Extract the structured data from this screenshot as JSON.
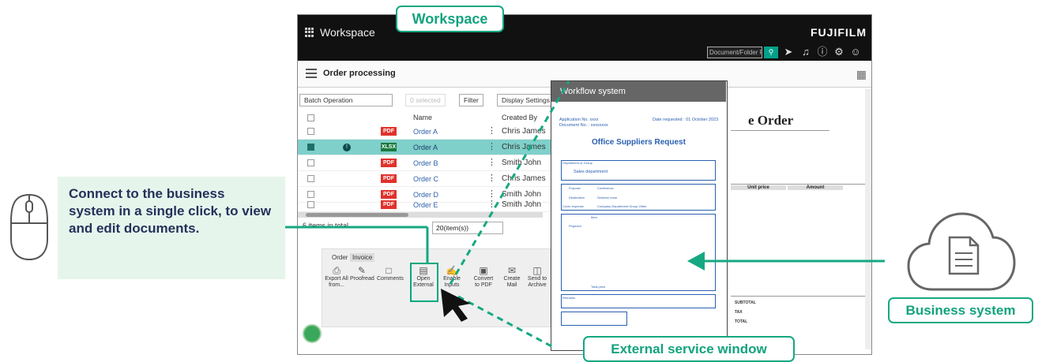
{
  "app": {
    "title": "Workspace",
    "brand": "FUJIFILM",
    "search_placeholder": "Document/Folder F"
  },
  "page": {
    "title": "Order processing"
  },
  "toolbar": {
    "batch": "Batch Operation",
    "unselect": "0 selected",
    "filter": "Filter",
    "display_settings": "Display Settings"
  },
  "table": {
    "headers": {
      "name": "Name",
      "created_by": "Created By"
    },
    "rows": [
      {
        "type": "PDF",
        "name": "Order A",
        "creator": "Chris James"
      },
      {
        "type": "XLSX",
        "name": "Order A",
        "creator": "Chris James"
      },
      {
        "type": "PDF",
        "name": "Order B",
        "creator": "Smith John"
      },
      {
        "type": "PDF",
        "name": "Order C",
        "creator": "Chris James"
      },
      {
        "type": "PDF",
        "name": "Order D",
        "creator": "Smith John"
      },
      {
        "type": "PDF",
        "name": "Order E",
        "creator": "Smith John"
      }
    ],
    "selected_index": 1
  },
  "footer": {
    "total": "6 items in total",
    "per_page": "20(item(s))"
  },
  "panel": {
    "tabs": [
      "Order",
      "Invoice"
    ],
    "actions": [
      "Export All from...",
      "Proofread",
      "Comments",
      "Open External",
      "Enable Inputs",
      "Convert to PDF",
      "Create Mail",
      "Send to Archive"
    ]
  },
  "doc_preview": {
    "title": "e Order",
    "labels": [
      "SUBTOTAL",
      "TAX",
      "TOTAL"
    ],
    "cols": [
      "Unit price",
      "Amount"
    ]
  },
  "workflow": {
    "header": "Workflow system",
    "app_no": "Application No. xxxx",
    "doc_no": "Document No. : xxxxxxxx",
    "date": "Date requested : 01 October 2023",
    "request_title": "Office Suppliers Request",
    "dept_headers": [
      "Department or Group",
      "Requested by",
      "User",
      "Signature"
    ],
    "dept_value": "Sales department",
    "purpose_label": "Purpose",
    "purpose_value": "Conference",
    "dest_label": "Destination",
    "dest_value": "Seminar room",
    "cost_label": "Cover expense",
    "cost_value": "Company  Department  Group  Other",
    "item_headers": [
      "Item",
      "Qty",
      "Unit price",
      "Total list price",
      "Remarks"
    ],
    "item_row": "Projector",
    "total_label": "Total price",
    "remarks_label": "Remarks"
  },
  "callouts": {
    "workspace": "Workspace",
    "external": "External service window",
    "business": "Business system",
    "description": "Connect to the business system in a single click, to view and edit documents."
  },
  "colors": {
    "accent": "#16a882",
    "selected_row": "#7fcfca",
    "callout_bg": "#e6f5ec"
  }
}
